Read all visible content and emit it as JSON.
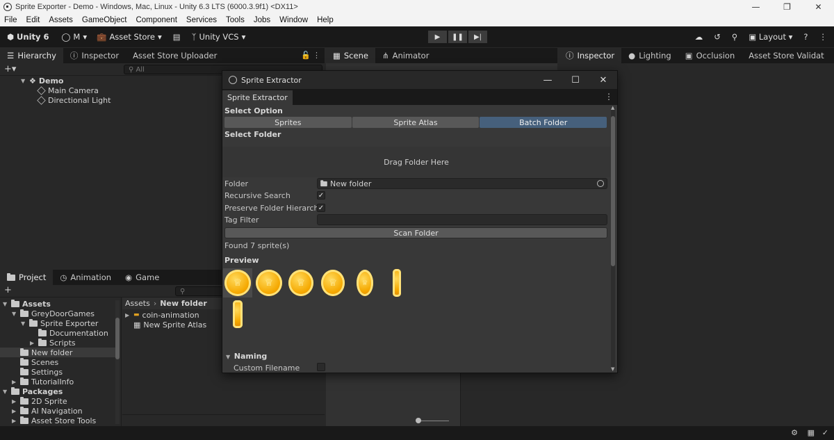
{
  "window": {
    "title": "Sprite Exporter - Demo - Windows, Mac, Linux - Unity 6.3 LTS (6000.3.9f1) <DX11>"
  },
  "menu": [
    "File",
    "Edit",
    "Assets",
    "GameObject",
    "Component",
    "Services",
    "Tools",
    "Jobs",
    "Window",
    "Help"
  ],
  "toolbar": {
    "unity_label": "Unity 6",
    "account_label": "M",
    "asset_store_label": "Asset Store",
    "vcs_label": "Unity VCS",
    "layout_label": "Layout"
  },
  "left_tabs": [
    "Hierarchy",
    "Inspector",
    "Asset Store Uploader"
  ],
  "hierarchy": {
    "search_placeholder": "All",
    "scene": "Demo",
    "objects": [
      "Main Camera",
      "Directional Light"
    ]
  },
  "scene_tabs": [
    "Scene",
    "Animator"
  ],
  "right_tabs": [
    "Inspector",
    "Lighting",
    "Occlusion",
    "Asset Store Validat"
  ],
  "bottom_tabs": [
    "Project",
    "Animation",
    "Game"
  ],
  "project": {
    "tree": [
      {
        "label": "Assets",
        "indent": 0,
        "bold": true,
        "open": true
      },
      {
        "label": "GreyDoorGames",
        "indent": 1,
        "open": true
      },
      {
        "label": "Sprite Exporter",
        "indent": 2,
        "open": true
      },
      {
        "label": "Documentation",
        "indent": 3
      },
      {
        "label": "Scripts",
        "indent": 3,
        "closed": true
      },
      {
        "label": "New folder",
        "indent": 1,
        "selected": true
      },
      {
        "label": "Scenes",
        "indent": 1
      },
      {
        "label": "Settings",
        "indent": 1
      },
      {
        "label": "TutorialInfo",
        "indent": 1,
        "closed": true
      },
      {
        "label": "Packages",
        "indent": 0,
        "bold": true,
        "open": true
      },
      {
        "label": "2D Sprite",
        "indent": 1,
        "closed": true
      },
      {
        "label": "AI Navigation",
        "indent": 1,
        "closed": true
      },
      {
        "label": "Asset Store Tools",
        "indent": 1,
        "closed": true
      }
    ],
    "breadcrumb": [
      "Assets",
      "New folder"
    ],
    "files": [
      "coin-animation",
      "New Sprite Atlas"
    ]
  },
  "dialog": {
    "title": "Sprite Extractor",
    "tab": "Sprite Extractor",
    "select_option_label": "Select Option",
    "options": [
      "Sprites",
      "Sprite Atlas",
      "Batch Folder"
    ],
    "selected_option": "Batch Folder",
    "select_folder_label": "Select Folder",
    "drop_text": "Drag Folder Here",
    "folder_label": "Folder",
    "folder_value": "New folder",
    "recursive_label": "Recursive Search",
    "recursive_checked": true,
    "preserve_label": "Preserve Folder Hierarchy",
    "preserve_checked": true,
    "tag_filter_label": "Tag Filter",
    "tag_filter_value": "",
    "scan_button": "Scan Folder",
    "found_text": "Found 7 sprite(s)",
    "preview_label": "Preview",
    "sprite_count": 7,
    "naming_label": "Naming",
    "custom_filename_label": "Custom Filename",
    "custom_filename_checked": false
  }
}
